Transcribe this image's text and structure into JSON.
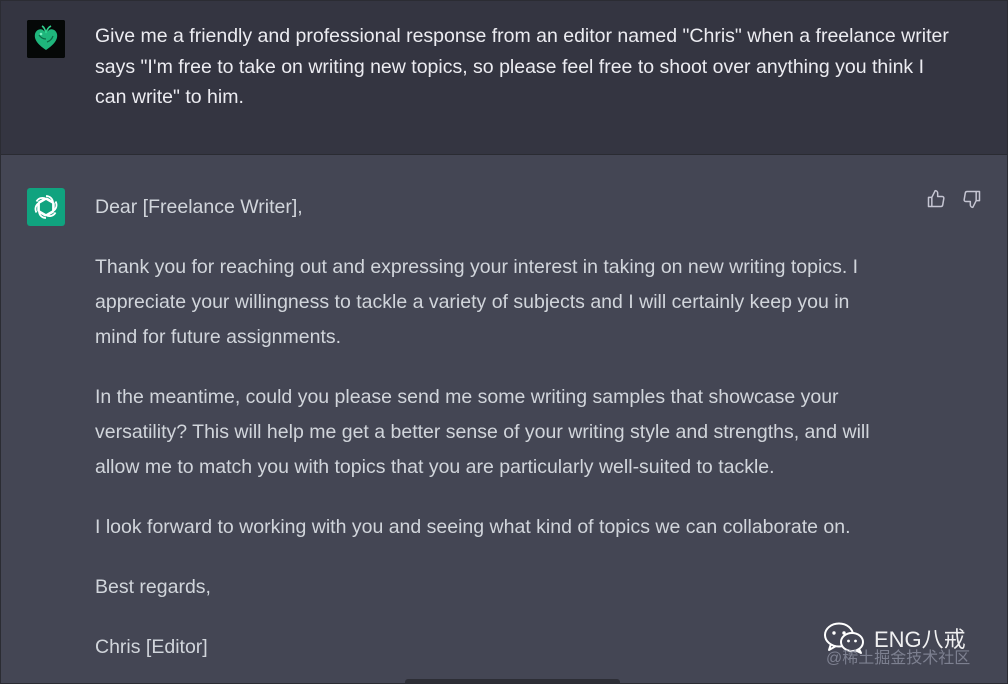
{
  "user_message": {
    "text": "Give me a friendly and professional response from an editor named \"Chris\" when a freelance writer says \"I'm free to take on writing new topics, so please feel free to shoot over anything you think I can write\" to him."
  },
  "assistant_message": {
    "paragraphs": [
      "Dear [Freelance Writer],",
      "Thank you for reaching out and expressing your interest in taking on new writing topics. I appreciate your willingness to tackle a variety of subjects and I will certainly keep you in mind for future assignments.",
      "In the meantime, could you please send me some writing samples that showcase your versatility? This will help me get a better sense of your writing style and strengths, and will allow me to match you with topics that you are particularly well-suited to tackle.",
      "I look forward to working with you and seeing what kind of topics we can collaborate on.",
      "Best regards,",
      "Chris [Editor]"
    ]
  },
  "feedback": {
    "thumbs_up_icon": "thumbs-up-icon",
    "thumbs_down_icon": "thumbs-down-icon"
  },
  "watermark": {
    "main": "ENG八戒",
    "sub": "@稀土掘金技术社区"
  },
  "colors": {
    "user_bg": "#343541",
    "assistant_bg": "#444654",
    "assistant_avatar": "#10a37f",
    "user_text": "#ececf1",
    "assistant_text": "#d1d5db"
  }
}
